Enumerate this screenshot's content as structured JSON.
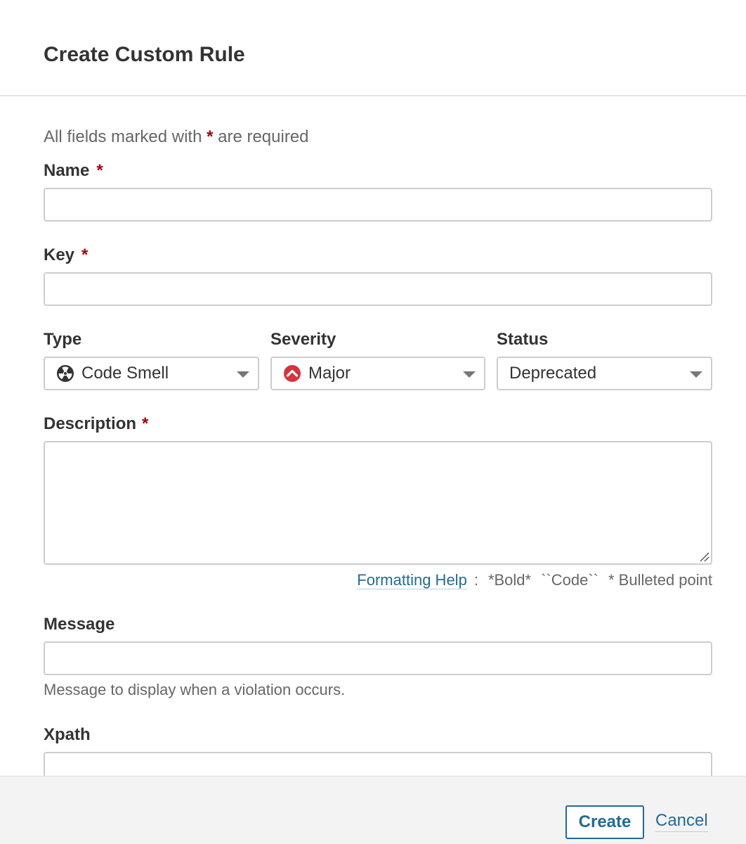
{
  "dialog": {
    "title": "Create Custom Rule"
  },
  "form": {
    "required_note_prefix": "All fields marked with",
    "required_marker": "*",
    "required_note_suffix": "are required",
    "name": {
      "label": "Name",
      "value": ""
    },
    "key": {
      "label": "Key",
      "value": ""
    },
    "type": {
      "label": "Type",
      "selected": "Code Smell",
      "icon": "code-smell-icon"
    },
    "severity": {
      "label": "Severity",
      "selected": "Major",
      "icon": "major-severity-icon"
    },
    "status": {
      "label": "Status",
      "selected": "Deprecated"
    },
    "description": {
      "label": "Description",
      "value": ""
    },
    "formatting": {
      "link_label": "Formatting Help",
      "separator": ":",
      "bold_example": "*Bold*",
      "code_example": "``Code``",
      "bullet_example": "* Bulleted point"
    },
    "message": {
      "label": "Message",
      "value": "",
      "hint": "Message to display when a violation occurs."
    },
    "xpath": {
      "label": "Xpath",
      "value": ""
    }
  },
  "footer": {
    "create_label": "Create",
    "cancel_label": "Cancel"
  },
  "colors": {
    "required": "#a4030f",
    "link": "#236a97",
    "border": "#cdcdcd",
    "severity_major": "#d4333f"
  }
}
